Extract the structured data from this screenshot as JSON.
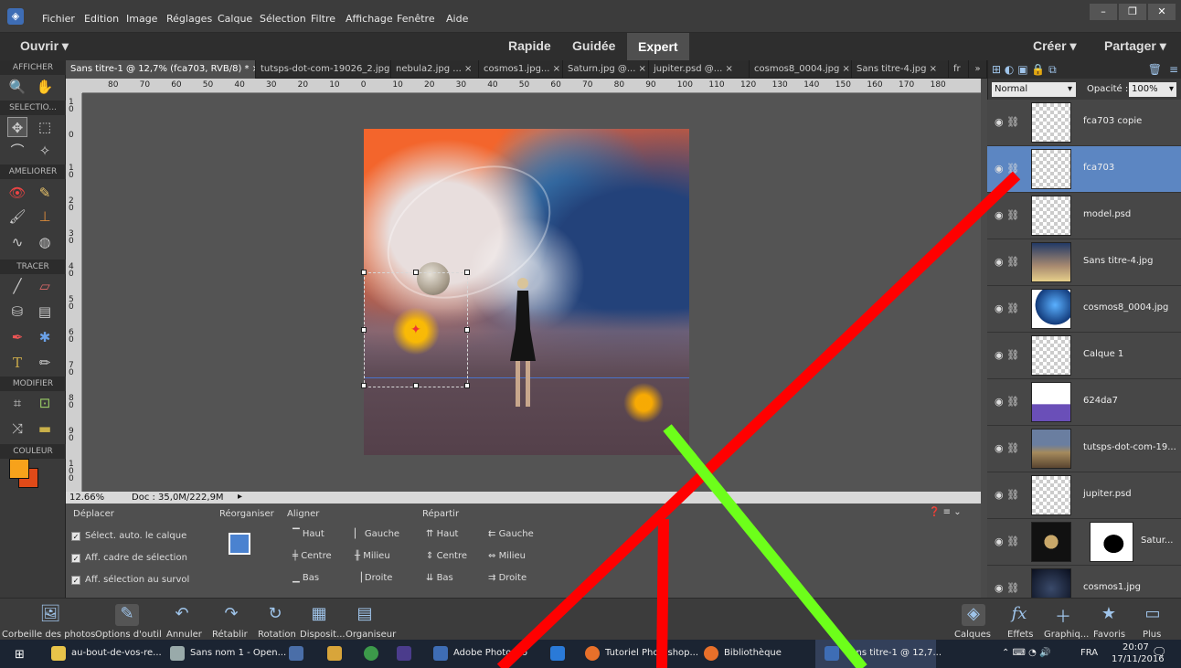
{
  "menu": {
    "items": [
      "Fichier",
      "Edition",
      "Image",
      "Réglages",
      "Calque",
      "Sélection",
      "Filtre",
      "Affichage",
      "Fenêtre",
      "Aide"
    ]
  },
  "modebar": {
    "open": "Ouvrir",
    "quick": "Rapide",
    "guided": "Guidée",
    "expert": "Expert",
    "create": "Créer",
    "share": "Partager"
  },
  "left": {
    "afficher": "AFFICHER",
    "selection": "SELECTIO...",
    "ameliorer": "AMELIORER",
    "tracer": "TRACER",
    "modifier": "MODIFIER",
    "couleur": "COULEUR"
  },
  "tabs": [
    "Sans titre-1 @ 12,7% (fca703, RVB/8) *",
    "tutsps-dot-com-19026_2.jpg",
    "nebula2.jpg ...",
    "cosmos1.jpg...",
    "Saturn.jpg @...",
    "jupiter.psd @...",
    "cosmos8_0004.jpg",
    "Sans titre-4.jpg",
    "fr"
  ],
  "ruler": {
    "h": [
      "80",
      "70",
      "60",
      "50",
      "40",
      "30",
      "20",
      "10",
      "0",
      "10",
      "20",
      "30",
      "40",
      "50",
      "60",
      "70",
      "80",
      "90",
      "100",
      "110",
      "120",
      "130",
      "140",
      "150",
      "160",
      "170",
      "180"
    ],
    "v": [
      "1\n0",
      "0",
      "1\n0",
      "2\n0",
      "3\n0",
      "4\n0",
      "5\n0",
      "6\n0",
      "7\n0",
      "8\n0",
      "9\n0",
      "1\n0\n0"
    ]
  },
  "status": {
    "zoom": "12.66%",
    "doc": "Doc : 35,0M/222,9M"
  },
  "options": {
    "title": "Déplacer",
    "rearrange": "Réorganiser",
    "align": "Aligner",
    "distribute": "Répartir",
    "checks": [
      "Sélect. auto. le calque",
      "Aff. cadre de sélection",
      "Aff. sélection au survol"
    ],
    "align_items": [
      "Haut",
      "Gauche",
      "Centre",
      "Milieu",
      "Bas",
      "Droite"
    ],
    "dist_items": [
      "Haut",
      "Gauche",
      "Centre",
      "Milieu",
      "Bas",
      "Droite"
    ]
  },
  "layers_panel": {
    "mode": "Normal",
    "opacity_label": "Opacité :",
    "opacity": "100%",
    "layers": [
      "fca703 copie",
      "fca703",
      "model.psd",
      "Sans titre-4.jpg",
      "cosmos8_0004.jpg",
      "Calque 1",
      "624da7",
      "tutsps-dot-com-19...",
      "jupiter.psd",
      "Satur...",
      "cosmos1.jpg"
    ]
  },
  "bottom": {
    "left": [
      "Corbeille des photos",
      "Options d'outil",
      "Annuler",
      "Rétablir",
      "Rotation",
      "Disposit...",
      "Organiseur"
    ],
    "right": [
      "Calques",
      "Effets",
      "Graphiq...",
      "Favoris",
      "Plus"
    ]
  },
  "taskbar": {
    "items": [
      "au-bout-de-vos-re...",
      "Sans nom 1 - Open...",
      "Adobe Photosho",
      "Tutoriel Photoshop...",
      "Bibliothèque",
      "Sans titre-1 @ 12,7..."
    ],
    "lang": "FRA",
    "time": "20:07",
    "date": "17/11/2016"
  },
  "colors": {
    "accent": "#5c86c2",
    "fg": "#f7a21b",
    "bg": "#e04a18",
    "red_overlay": "#ff0000",
    "green_overlay": "#6dff1a"
  }
}
